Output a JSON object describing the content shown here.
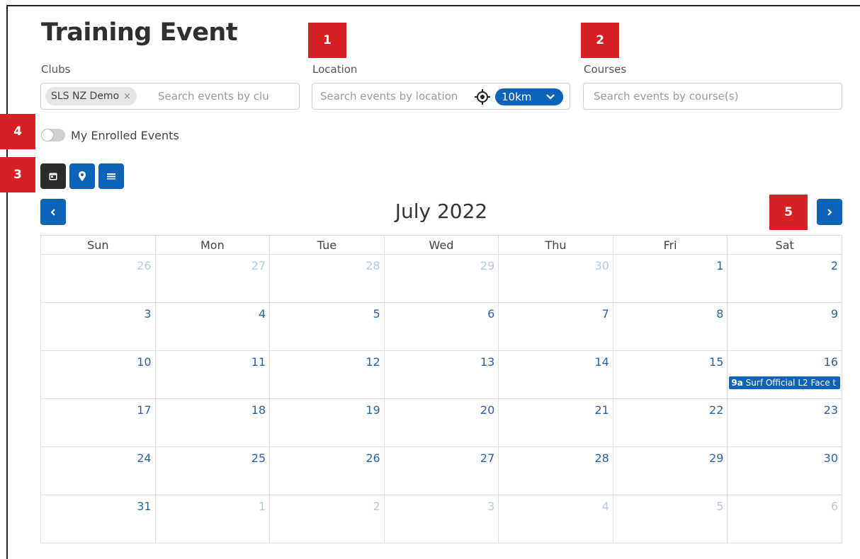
{
  "page": {
    "title": "Training Event"
  },
  "filters": {
    "clubs": {
      "label": "Clubs",
      "chip": "SLS NZ Demo",
      "chip_remove": "×",
      "placeholder": "Search events by clu"
    },
    "location": {
      "label": "Location",
      "placeholder": "Search events by location",
      "radius": "10km"
    },
    "courses": {
      "label": "Courses",
      "placeholder": "Search events by course(s)"
    }
  },
  "badges": {
    "b1": "1",
    "b2": "2",
    "b3": "3",
    "b4": "4",
    "b5": "5"
  },
  "toggle": {
    "label": "My Enrolled Events",
    "on": false
  },
  "views": {
    "active": "calendar",
    "items": [
      "calendar-icon",
      "map-pin-icon",
      "list-icon"
    ]
  },
  "calendar": {
    "month_label": "July 2022",
    "prev": "‹",
    "next": "›",
    "weekdays": [
      "Sun",
      "Mon",
      "Tue",
      "Wed",
      "Thu",
      "Fri",
      "Sat"
    ],
    "weeks": [
      [
        "26",
        "27",
        "28",
        "29",
        "30",
        "1",
        "2"
      ],
      [
        "3",
        "4",
        "5",
        "6",
        "7",
        "8",
        "9"
      ],
      [
        "10",
        "11",
        "12",
        "13",
        "14",
        "15",
        "16"
      ],
      [
        "17",
        "18",
        "19",
        "20",
        "21",
        "22",
        "23"
      ],
      [
        "24",
        "25",
        "26",
        "27",
        "28",
        "29",
        "30"
      ],
      [
        "31",
        "1",
        "2",
        "3",
        "4",
        "5",
        "6"
      ]
    ],
    "other_month": [
      [
        1,
        1,
        1,
        1,
        1,
        0,
        0
      ],
      [
        0,
        0,
        0,
        0,
        0,
        0,
        0
      ],
      [
        0,
        0,
        0,
        0,
        0,
        0,
        0
      ],
      [
        0,
        0,
        0,
        0,
        0,
        0,
        0
      ],
      [
        0,
        0,
        0,
        0,
        0,
        0,
        0
      ],
      [
        0,
        1,
        1,
        1,
        1,
        1,
        1
      ]
    ],
    "event": {
      "time": "9a",
      "title": "Surf Official L2 Face t"
    }
  },
  "colors": {
    "accent": "#0d63b8",
    "badge": "#d71f26",
    "active_view": "#2b2b2b"
  }
}
